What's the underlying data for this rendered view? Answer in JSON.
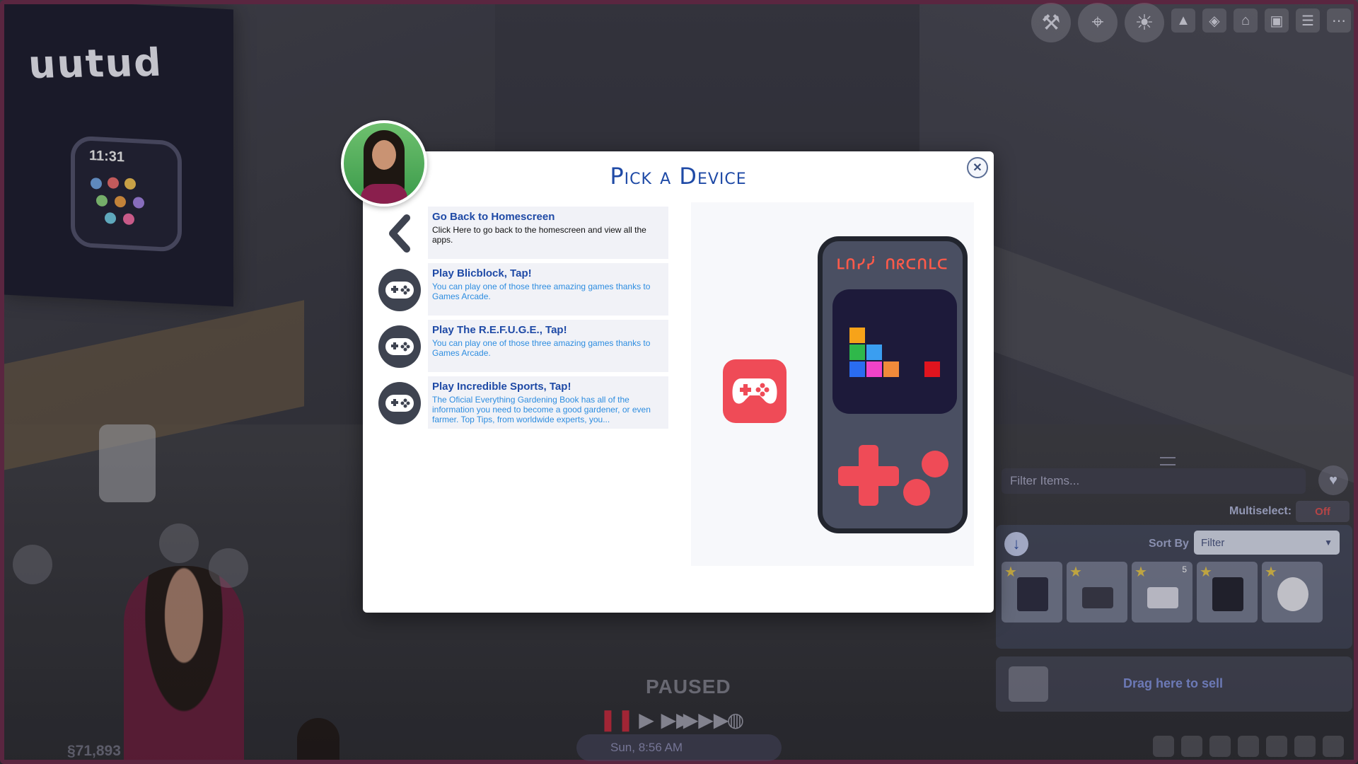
{
  "dialog": {
    "title": "Pick a Device",
    "close_label": "✕"
  },
  "options": [
    {
      "icon": "back-chevron-icon",
      "title": "Go Back to Homescreen",
      "description": "Click Here to go back to the homescreen and view all the apps."
    },
    {
      "icon": "gamepad-icon",
      "title": "Play Blicblock, Tap!",
      "description": "You can play one of those three amazing games thanks to Games Arcade."
    },
    {
      "icon": "gamepad-icon",
      "title": "Play The R.E.F.U.G.E., Tap!",
      "description": "You can play one of those three amazing games thanks to Games Arcade."
    },
    {
      "icon": "gamepad-icon",
      "title": "Play Incredible Sports, Tap!",
      "description": "The Oficial Everything Gardening Book has all of the information you need to become a good gardener, or even farmer. Top Tips, from worldwide experts, you..."
    }
  ],
  "preview": {
    "app_icon": "gamepad-app-icon",
    "device_title": "ᒪᑎᓯᓰ ᑎᖇᑕᑎᒪᑕ",
    "colors": {
      "accent": "#ef4b57",
      "device_body": "#4a4f62",
      "screen": "#1d1a3a"
    }
  },
  "catalog": {
    "filter_placeholder": "Filter Items...",
    "multiselect_label": "Multiselect:",
    "multiselect_value": "Off",
    "sort_label": "Sort By",
    "sort_value": "Filter",
    "item_count_badge": "5",
    "sell_label": "Drag here to sell"
  },
  "hud": {
    "paused_label": "PAUSED",
    "clock": "Sun, 8:56 AM",
    "funds": "§71,893"
  },
  "background": {
    "poster_text": "uutud",
    "poster_time": "11:31"
  }
}
